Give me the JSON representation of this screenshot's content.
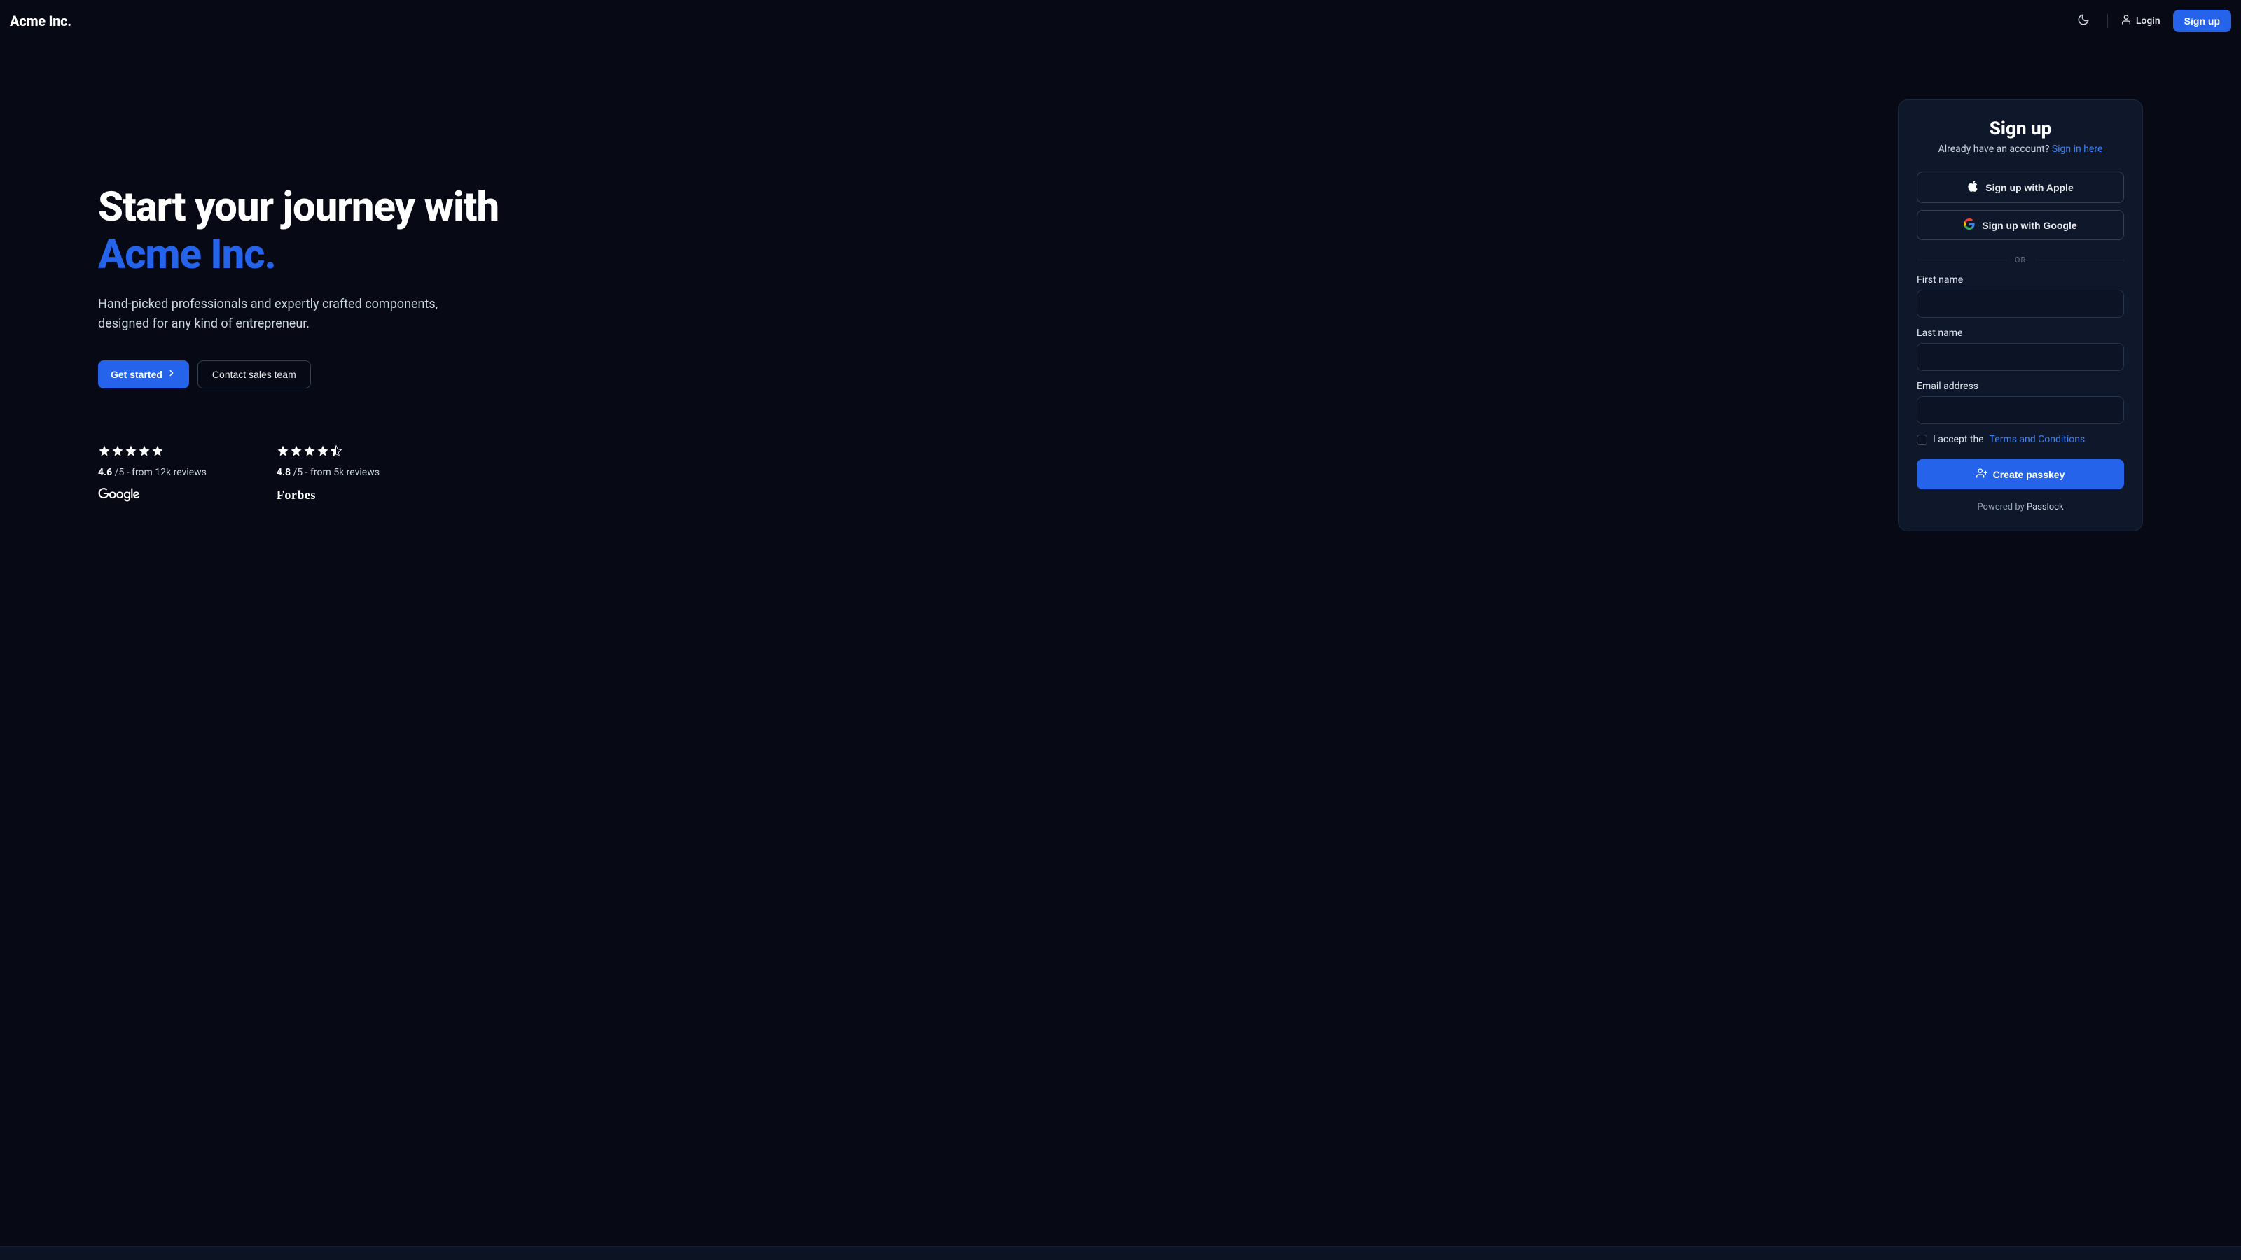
{
  "header": {
    "brand": "Acme Inc.",
    "login_label": "Login",
    "signup_label": "Sign up"
  },
  "hero": {
    "title_prefix": "Start your journey with ",
    "title_accent": "Acme Inc.",
    "subtitle": "Hand-picked professionals and expertly crafted components, designed for any kind of entrepreneur.",
    "cta_primary": "Get started",
    "cta_secondary": "Contact sales team"
  },
  "reviews": [
    {
      "score": "4.6",
      "out_of": "/5",
      "tail": " - from 12k reviews",
      "source": "Google",
      "stars": 5,
      "half": false
    },
    {
      "score": "4.8",
      "out_of": "/5",
      "tail": " - from 5k reviews",
      "source": "Forbes",
      "stars": 4,
      "half": true
    }
  ],
  "signup": {
    "title": "Sign up",
    "already_prefix": "Already have an account? ",
    "signin_link": "Sign in here",
    "apple_label": "Sign up with Apple",
    "google_label": "Sign up with Google",
    "or_label": "OR",
    "fields": {
      "first_name_label": "First name",
      "last_name_label": "Last name",
      "email_label": "Email address"
    },
    "terms_prefix": "I accept the ",
    "terms_link": "Terms and Conditions",
    "create_label": "Create passkey",
    "powered_prefix": "Powered by ",
    "powered_brand": "Passlock"
  },
  "colors": {
    "accent": "#2563eb",
    "bg": "#070a14",
    "card": "#0f172a"
  }
}
